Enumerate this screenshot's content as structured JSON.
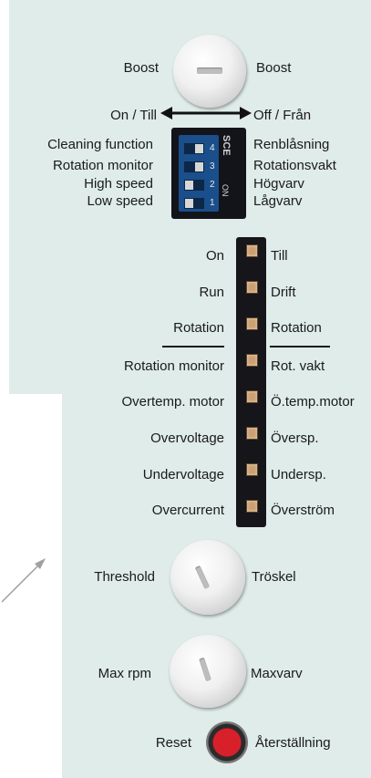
{
  "boost": {
    "left": "Boost",
    "right": "Boost"
  },
  "on_off": {
    "left": "On / Till",
    "right": "Off / Från"
  },
  "dip_switch": {
    "brand": "SCE",
    "on_mark": "ON",
    "numbers": [
      "4",
      "3",
      "2",
      "1"
    ],
    "states": [
      "off",
      "off",
      "on",
      "on"
    ],
    "labels_en": [
      "Cleaning function",
      "Rotation monitor",
      "High speed",
      "Low speed"
    ],
    "labels_sv": [
      "Renblåsning",
      "Rotationsvakt",
      "Högvarv",
      "Lågvarv"
    ]
  },
  "indicators_en": [
    "On",
    "Run",
    "Rotation",
    "Rotation monitor",
    "Overtemp. motor",
    "Overvoltage",
    "Undervoltage",
    "Overcurrent"
  ],
  "indicators_sv": [
    "Till",
    "Drift",
    "Rotation",
    "Rot. vakt",
    "Ö.temp.motor",
    "Översp.",
    "Undersp.",
    "Överström"
  ],
  "threshold": {
    "left": "Threshold",
    "right": "Tröskel"
  },
  "max_rpm": {
    "left": "Max rpm",
    "right": "Maxvarv"
  },
  "reset": {
    "left": "Reset",
    "right": "Återställning"
  },
  "colors": {
    "panel": "#dfece9",
    "dip_body": "#1a4f8c",
    "led": "#caa074",
    "reset_button": "#d8202b",
    "pointer_arrow": "#a0a0a0"
  }
}
